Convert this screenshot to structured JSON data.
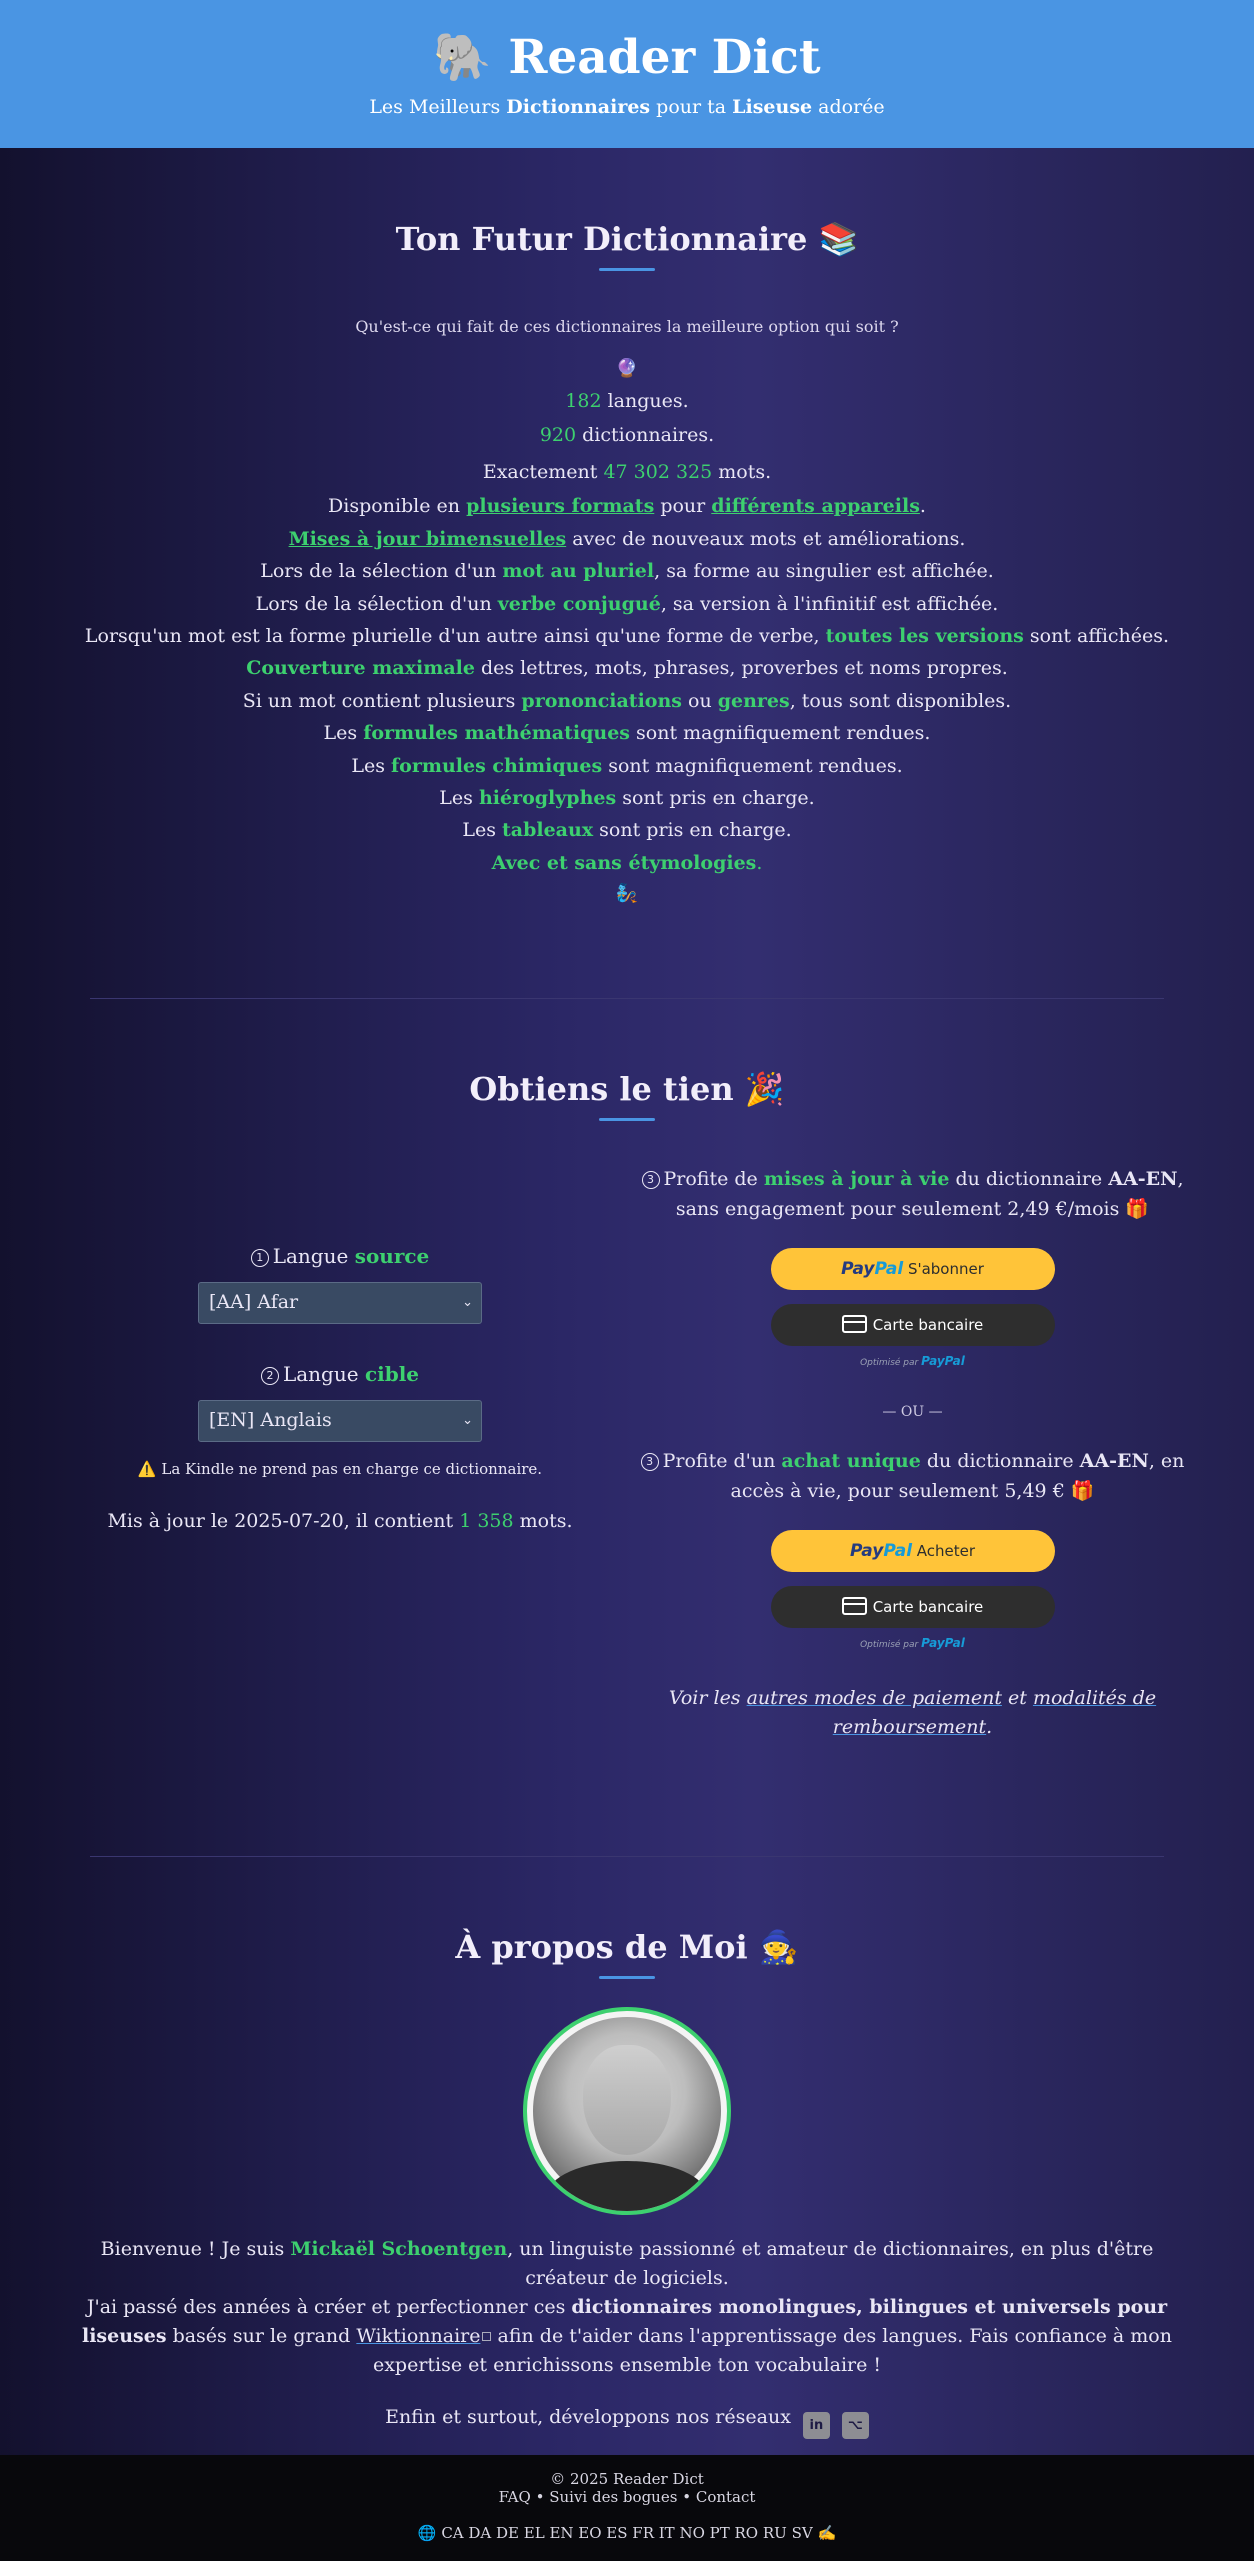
{
  "header": {
    "logo_emoji": "🐘",
    "title": "Reader Dict",
    "subtitle_1": "Les Meilleurs ",
    "subtitle_2": "Dictionnaires",
    "subtitle_3": " pour ta ",
    "subtitle_4": "Liseuse",
    "subtitle_5": " adorée"
  },
  "features": {
    "title": "Ton Futur Dictionnaire 📚",
    "question": "Qu'est-ce qui fait de ces dictionnaires la meilleure option qui soit ?",
    "top_emoji": "🔮",
    "langs_count": "182",
    "langs_text": " langues.",
    "dicts_count": "920",
    "dicts_text": " dictionnaires.",
    "words_pre": "Exactement ",
    "words_count": "47 302 325",
    "words_text": " mots.",
    "l4a": "Disponible en ",
    "l4b": "plusieurs formats",
    "l4c": " pour ",
    "l4d": "différents appareils",
    "l4e": ".",
    "l5a": "Mises à jour bimensuelles",
    "l5b": " avec de nouveaux mots et améliorations.",
    "l6a": "Lors de la sélection d'un ",
    "l6b": "mot au pluriel",
    "l6c": ", sa forme au singulier est affichée.",
    "l7a": "Lors de la sélection d'un ",
    "l7b": "verbe conjugué",
    "l7c": ", sa version à l'infinitif est affichée.",
    "l8a": "Lorsqu'un mot est la forme plurielle d'un autre ainsi qu'une forme de verbe, ",
    "l8b": "toutes les versions",
    "l8c": " sont affichées.",
    "l9a": "Couverture maximale",
    "l9b": " des lettres, mots, phrases, proverbes et noms propres.",
    "l10a": "Si un mot contient plusieurs ",
    "l10b": "prononciations",
    "l10c": " ou ",
    "l10d": "genres",
    "l10e": ", tous sont disponibles.",
    "l11a": "Les ",
    "l11b": "formules mathématiques",
    "l11c": " sont magnifiquement rendues.",
    "l12a": "Les ",
    "l12b": "formules chimiques",
    "l12c": " sont magnifiquement rendues.",
    "l13a": "Les ",
    "l13b": "hiéroglyphes",
    "l13c": " sont pris en charge.",
    "l14a": "Les ",
    "l14b": "tableaux",
    "l14c": " sont pris en charge.",
    "l15a": "Avec et sans étymologies",
    "l15b": ".",
    "bottom_emoji": "🧞"
  },
  "get": {
    "title": "Obtiens le tien 🎉",
    "source_num": "1",
    "source_label": "Langue ",
    "source_em": "source",
    "source_value": "[AA] Afar",
    "target_num": "2",
    "target_label": "Langue ",
    "target_em": "cible",
    "target_value": "[EN] Anglais",
    "warning": "⚠️ La Kindle ne prend pas en charge ce dictionnaire.",
    "updated_pre": "Mis à jour le 2025-07-20, il contient ",
    "updated_count": "1 358",
    "updated_post": " mots.",
    "offer1_num": "3",
    "offer1_a": "Profite de ",
    "offer1_b": "mises à jour à vie",
    "offer1_c": " du dictionnaire ",
    "offer1_d": "AA-EN",
    "offer1_e": ", sans engagement pour seulement 2,49 €/mois 🎁",
    "paypal_1": "Pay",
    "paypal_2": "Pal",
    "subscribe_label": "S'abonner",
    "card_label": "Carte bancaire",
    "powered_by": "Optimisé par ",
    "powered_brand": "PayPal",
    "or_label": "— OU —",
    "offer2_num": "3",
    "offer2_a": "Profite d'un ",
    "offer2_b": "achat unique",
    "offer2_c": " du dictionnaire ",
    "offer2_d": "AA-EN",
    "offer2_e": ", en accès à vie, pour seulement 5,49 € 🎁",
    "buy_label": "Acheter",
    "other_a": "Voir les ",
    "other_b": "autres modes de paiement",
    "other_c": " et ",
    "other_d": "modalités de remboursement",
    "other_e": "."
  },
  "about": {
    "title": "À propos de Moi 🧙",
    "bio_a": "Bienvenue ! Je suis ",
    "bio_name": "Mickaël Schoentgen",
    "bio_b": ", un linguiste passionné et amateur de dictionnaires, en plus d'être créateur de logiciels.",
    "bio_c": "J'ai passé des années à créer et perfectionner ces ",
    "bio_d": "dictionnaires monolingues, bilingues et universels pour liseuses",
    "bio_e": " basés sur le grand ",
    "bio_link": "Wiktionnaire",
    "bio_f": " afin de t'aider dans l'apprentissage des langues. Fais confiance à mon expertise et enrichissons ensemble ton vocabulaire !",
    "social_text": "Enfin et surtout, développons nos réseaux",
    "linkedin_glyph": "in",
    "github_glyph": "⌥"
  },
  "footer": {
    "copyright": "© 2025 Reader Dict",
    "faq": "FAQ",
    "sep1": "•",
    "bugs": "Suivi des bogues",
    "sep2": "•",
    "contact": "Contact",
    "langs_globe": "🌐",
    "langs": "CA DA DE EL EN EO ES FR IT NO PT RO RU SV",
    "langs_hand": "✍️"
  }
}
